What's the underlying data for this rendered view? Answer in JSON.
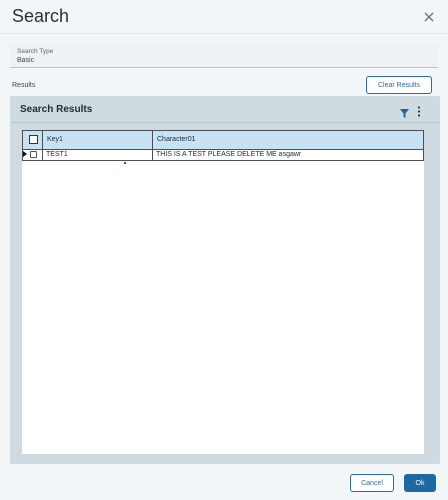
{
  "dialog": {
    "title": "Search"
  },
  "search_type": {
    "label": "Search Type",
    "value": "Basic"
  },
  "results": {
    "label": "Results",
    "clear_button": "Clear Results"
  },
  "panel": {
    "title": "Search Results"
  },
  "grid": {
    "columns": [
      "Key1",
      "Character01"
    ],
    "rows": [
      {
        "key1": "TEST1",
        "character01": "THIS IS A TEST PLEASE DELETE ME asgawr"
      }
    ]
  },
  "footer": {
    "cancel_label": "Cancel",
    "ok_label": "Ok"
  },
  "colors": {
    "accent": "#1d6aa3",
    "header_row": "#c6e2f3",
    "panel_bg": "#cfdbe0"
  }
}
